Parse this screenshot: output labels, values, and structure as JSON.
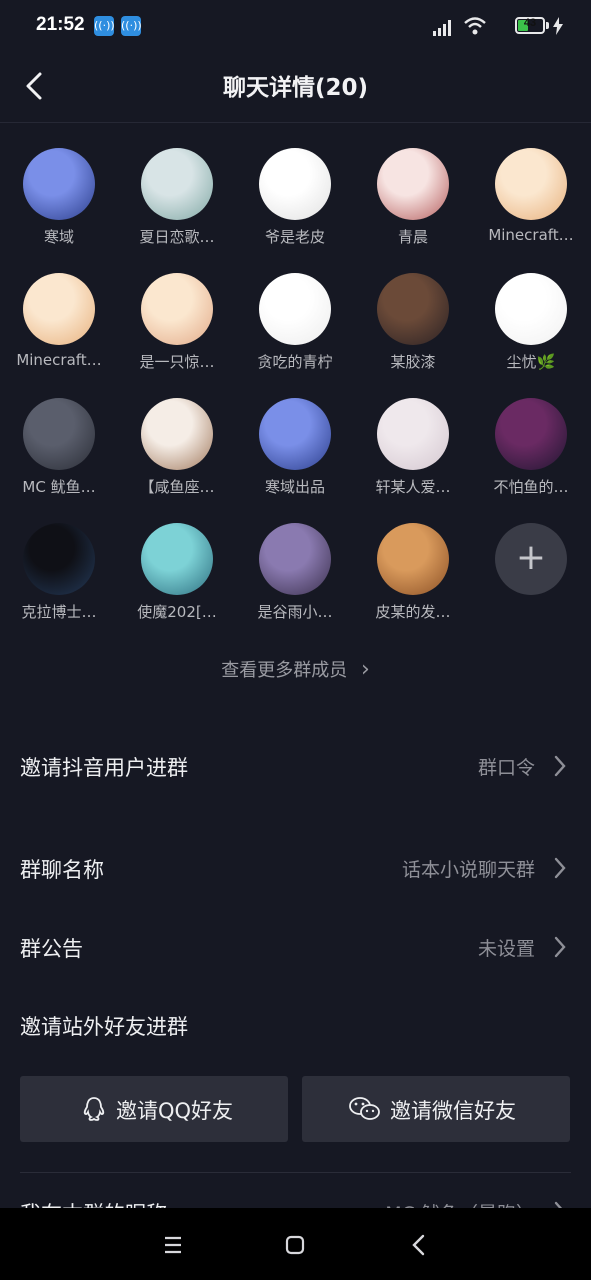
{
  "status_bar": {
    "time": "21:52",
    "battery": "43",
    "battery_level": 0.43
  },
  "header": {
    "title": "聊天详情(20)"
  },
  "members": [
    {
      "name": "寒域",
      "color1": "#7a8fe8",
      "color2": "#2b3d8a"
    },
    {
      "name": "夏日恋歌…",
      "color1": "#d8e4e6",
      "color2": "#7fa7a3"
    },
    {
      "name": "爷是老皮",
      "color1": "#ffffff",
      "color2": "#e0e0e0"
    },
    {
      "name": "青晨",
      "color1": "#f7e4e2",
      "color2": "#b45c5c"
    },
    {
      "name": "Minecraft…",
      "color1": "#fbe7cf",
      "color2": "#e7b07c"
    },
    {
      "name": "Minecraft…",
      "color1": "#fbe7cf",
      "color2": "#e7b07c"
    },
    {
      "name": "是一只惊…",
      "color1": "#fbe7cf",
      "color2": "#e2a987"
    },
    {
      "name": "贪吃的青柠",
      "color1": "#ffffff",
      "color2": "#ececec"
    },
    {
      "name": "某胶漆",
      "color1": "#6b4a38",
      "color2": "#2a2124"
    },
    {
      "name": "尘忧🌿",
      "color1": "#ffffff",
      "color2": "#f0f0f0"
    },
    {
      "name": "MC 鱿鱼…",
      "color1": "#5a5e6c",
      "color2": "#2a2d36"
    },
    {
      "name": "【咸鱼座…",
      "color1": "#f5ede6",
      "color2": "#a0785c"
    },
    {
      "name": "寒域出品",
      "color1": "#7a8fe8",
      "color2": "#2b3d8a"
    },
    {
      "name": "轩某人爱…",
      "color1": "#efe8ec",
      "color2": "#d3c6cf"
    },
    {
      "name": "不怕鱼的…",
      "color1": "#6a2a63",
      "color2": "#1f1630"
    },
    {
      "name": "克拉博士…",
      "color1": "#0f1016",
      "color2": "#243a5a"
    },
    {
      "name": "使魔202[…",
      "color1": "#7dd2d6",
      "color2": "#2c6d7e"
    },
    {
      "name": "是谷雨小…",
      "color1": "#8a7ab0",
      "color2": "#3a2f4c"
    },
    {
      "name": "皮某的发…",
      "color1": "#d99a5c",
      "color2": "#8a4f25"
    }
  ],
  "add_member_symbol": "+",
  "view_more": "查看更多群成员",
  "view_more_chevron": "›",
  "rows": {
    "invite_douyin": {
      "label": "邀请抖音用户进群",
      "value": "群口令"
    },
    "group_name": {
      "label": "群聊名称",
      "value": "话本小说聊天群"
    },
    "announcement": {
      "label": "群公告",
      "value": "未设置"
    },
    "invite_external": {
      "label": "邀请站外好友进群"
    },
    "my_nickname": {
      "label": "我在本群的昵称",
      "value": "MC 鱿鱼（暴跑）"
    }
  },
  "invite_buttons": {
    "qq": "邀请QQ好友",
    "wechat": "邀请微信好友"
  },
  "icons": [
    "back-icon",
    "qq-icon",
    "wechat-icon",
    "chevron-right-icon",
    "menu-icon",
    "home-icon",
    "back-nav-icon",
    "wifi-icon",
    "signal-icon",
    "battery-icon"
  ]
}
